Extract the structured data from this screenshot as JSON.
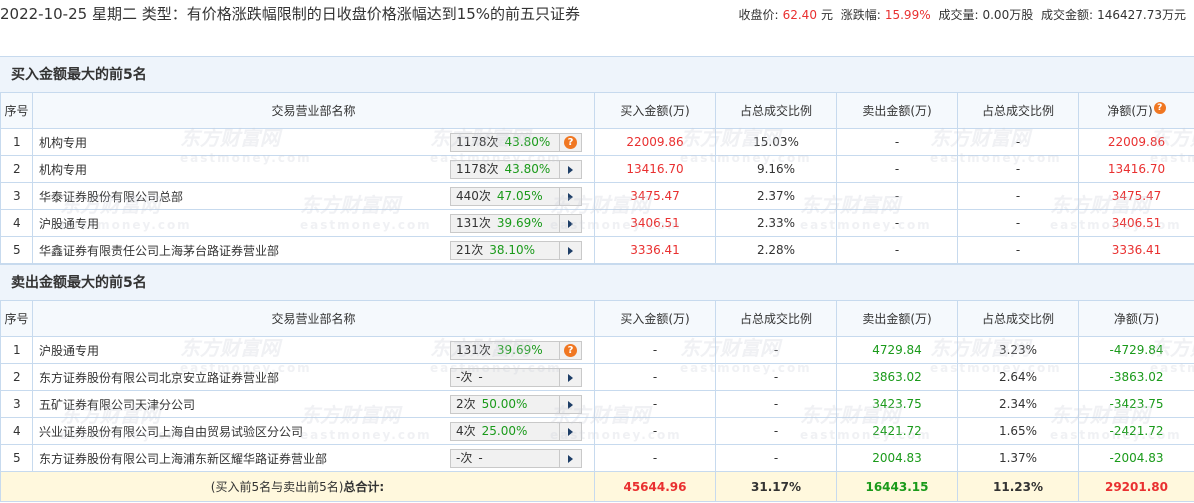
{
  "header": {
    "title": "2022-10-25 星期二 类型：有价格涨跌幅限制的日收盘价格涨幅达到15%的前五只证券",
    "close_label": "收盘价:",
    "close_value": "62.40",
    "close_unit": "元",
    "change_label": "涨跌幅:",
    "change_value": "15.99%",
    "volume_label": "成交量:",
    "volume_value": "0.00万股",
    "amount_label": "成交金额:",
    "amount_value": "146427.73万元"
  },
  "buy_section": {
    "title": "买入金额最大的前5名",
    "columns": [
      "序号",
      "交易营业部名称",
      "买入金额(万)",
      "占总成交比例",
      "卖出金额(万)",
      "占总成交比例",
      "净额(万)"
    ],
    "rows": [
      {
        "idx": "1",
        "name": "机构专用",
        "count": "1178次",
        "pct": "43.80%",
        "buy": "22009.86",
        "buy_ratio": "15.03%",
        "sell": "-",
        "sell_ratio": "-",
        "net": "22009.86"
      },
      {
        "idx": "2",
        "name": "机构专用",
        "count": "1178次",
        "pct": "43.80%",
        "buy": "13416.70",
        "buy_ratio": "9.16%",
        "sell": "-",
        "sell_ratio": "-",
        "net": "13416.70"
      },
      {
        "idx": "3",
        "name": "华泰证券股份有限公司总部",
        "count": "440次",
        "pct": "47.05%",
        "buy": "3475.47",
        "buy_ratio": "2.37%",
        "sell": "-",
        "sell_ratio": "-",
        "net": "3475.47"
      },
      {
        "idx": "4",
        "name": "沪股通专用",
        "count": "131次",
        "pct": "39.69%",
        "buy": "3406.51",
        "buy_ratio": "2.33%",
        "sell": "-",
        "sell_ratio": "-",
        "net": "3406.51"
      },
      {
        "idx": "5",
        "name": "华鑫证券有限责任公司上海茅台路证券营业部",
        "count": "21次",
        "pct": "38.10%",
        "buy": "3336.41",
        "buy_ratio": "2.28%",
        "sell": "-",
        "sell_ratio": "-",
        "net": "3336.41"
      }
    ]
  },
  "sell_section": {
    "title": "卖出金额最大的前5名",
    "columns": [
      "序号",
      "交易营业部名称",
      "买入金额(万)",
      "占总成交比例",
      "卖出金额(万)",
      "占总成交比例",
      "净额(万)"
    ],
    "rows": [
      {
        "idx": "1",
        "name": "沪股通专用",
        "count": "131次",
        "pct": "39.69%",
        "buy": "-",
        "buy_ratio": "-",
        "sell": "4729.84",
        "sell_ratio": "3.23%",
        "net": "-4729.84"
      },
      {
        "idx": "2",
        "name": "东方证券股份有限公司北京安立路证券营业部",
        "count": "-次",
        "pct": "-",
        "buy": "-",
        "buy_ratio": "-",
        "sell": "3863.02",
        "sell_ratio": "2.64%",
        "net": "-3863.02"
      },
      {
        "idx": "3",
        "name": "五矿证券有限公司天津分公司",
        "count": "2次",
        "pct": "50.00%",
        "buy": "-",
        "buy_ratio": "-",
        "sell": "3423.75",
        "sell_ratio": "2.34%",
        "net": "-3423.75"
      },
      {
        "idx": "4",
        "name": "兴业证券股份有限公司上海自由贸易试验区分公司",
        "count": "4次",
        "pct": "25.00%",
        "buy": "-",
        "buy_ratio": "-",
        "sell": "2421.72",
        "sell_ratio": "1.65%",
        "net": "-2421.72"
      },
      {
        "idx": "5",
        "name": "东方证券股份有限公司上海浦东新区耀华路证券营业部",
        "count": "-次",
        "pct": "-",
        "buy": "-",
        "buy_ratio": "-",
        "sell": "2004.83",
        "sell_ratio": "1.37%",
        "net": "-2004.83"
      }
    ]
  },
  "total": {
    "label_prefix": "(买入前5名与卖出前5名)",
    "label_bold": "总合计:",
    "buy": "45644.96",
    "buy_ratio": "31.17%",
    "sell": "16443.15",
    "sell_ratio": "11.23%",
    "net": "29201.80"
  },
  "watermark": {
    "text": "东方财富网",
    "sub": "eastmoney.com"
  },
  "icons": {
    "help": "help-icon",
    "detail": "triangle-right-icon"
  },
  "colors": {
    "up": "#e93030",
    "down": "#1a9a1a",
    "header_bg": "#eef4fb",
    "border": "#c7daee",
    "help": "#f07722"
  }
}
